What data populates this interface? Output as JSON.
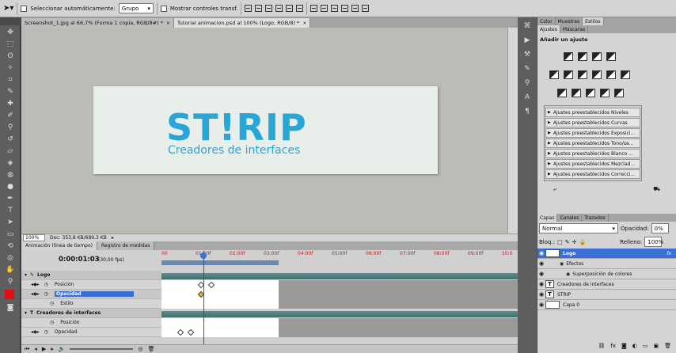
{
  "options": {
    "auto_select_label": "Seleccionar automáticamente:",
    "auto_select_value": "Grupo",
    "show_controls_label": "Mostrar controles transf."
  },
  "tabs": [
    {
      "label": "Screenshot_1.jpg al 66,7% (Forma 1 copia, RGB/8#) *",
      "close": "×"
    },
    {
      "label": "Tutorial animacion.psd al 100% (Logo, RGB/8) *",
      "close": "×"
    }
  ],
  "canvas": {
    "logo_title": "ST!RIP",
    "logo_subtitle": "Creadores de interfaces",
    "accent": "#2aa6d6"
  },
  "status": {
    "zoom": "100%",
    "doc": "Doc: 353,8 KB/689,3 KB"
  },
  "animation": {
    "tabs": [
      "Animación (línea de tiempo)",
      "Registro de medidas"
    ],
    "timecode": "0:00:01:03",
    "fps": "(30,00 fps)",
    "ruler": [
      "00",
      "01:00f",
      "02:00f",
      "03:00f",
      "04:00f",
      "05:00f",
      "06:00f",
      "07:00f",
      "08:00f",
      "09:00f",
      "10:0"
    ],
    "rows": [
      {
        "label": "Logo",
        "type": "group"
      },
      {
        "label": "Posición",
        "type": "prop"
      },
      {
        "label": "Opacidad",
        "type": "prop-selected"
      },
      {
        "label": "Estilo",
        "type": "prop"
      },
      {
        "label": "Creadores de interfaces",
        "type": "group"
      },
      {
        "label": "Posición",
        "type": "prop"
      },
      {
        "label": "Opacidad",
        "type": "prop"
      }
    ]
  },
  "panel": {
    "color_tabs": [
      "Color",
      "Muestras",
      "Estilos"
    ],
    "adjust_tabs": [
      "Ajustes",
      "Máscaras"
    ],
    "add_adjust": "Añadir un ajuste",
    "presets": [
      "Ajustes preestablecidos Niveles",
      "Ajustes preestablecidos Curvas",
      "Ajustes preestablecidos Exposici...",
      "Ajustes preestablecidos Tono/sa...",
      "Ajustes preestablecidos Blanco ...",
      "Ajustes preestablecidos Mezclad...",
      "Ajustes preestablecidos Correcci..."
    ],
    "layer_tabs": [
      "Capas",
      "Canales",
      "Trazados"
    ],
    "blend": "Normal",
    "opacity_label": "Opacidad:",
    "opacity": "0%",
    "lock_label": "Bloq.:",
    "fill_label": "Relleno:",
    "fill": "100%",
    "layers": [
      {
        "name": "Logo",
        "kind": "group",
        "selected": true,
        "fx": "fx"
      },
      {
        "name": "Efectos",
        "kind": "effects"
      },
      {
        "name": "Superposición de colores",
        "kind": "effect"
      },
      {
        "name": "Creadores de interfaces",
        "kind": "text",
        "thumb": "T"
      },
      {
        "name": "STRIP",
        "kind": "text",
        "thumb": "T"
      },
      {
        "name": "Capa 0",
        "kind": "image"
      }
    ]
  }
}
